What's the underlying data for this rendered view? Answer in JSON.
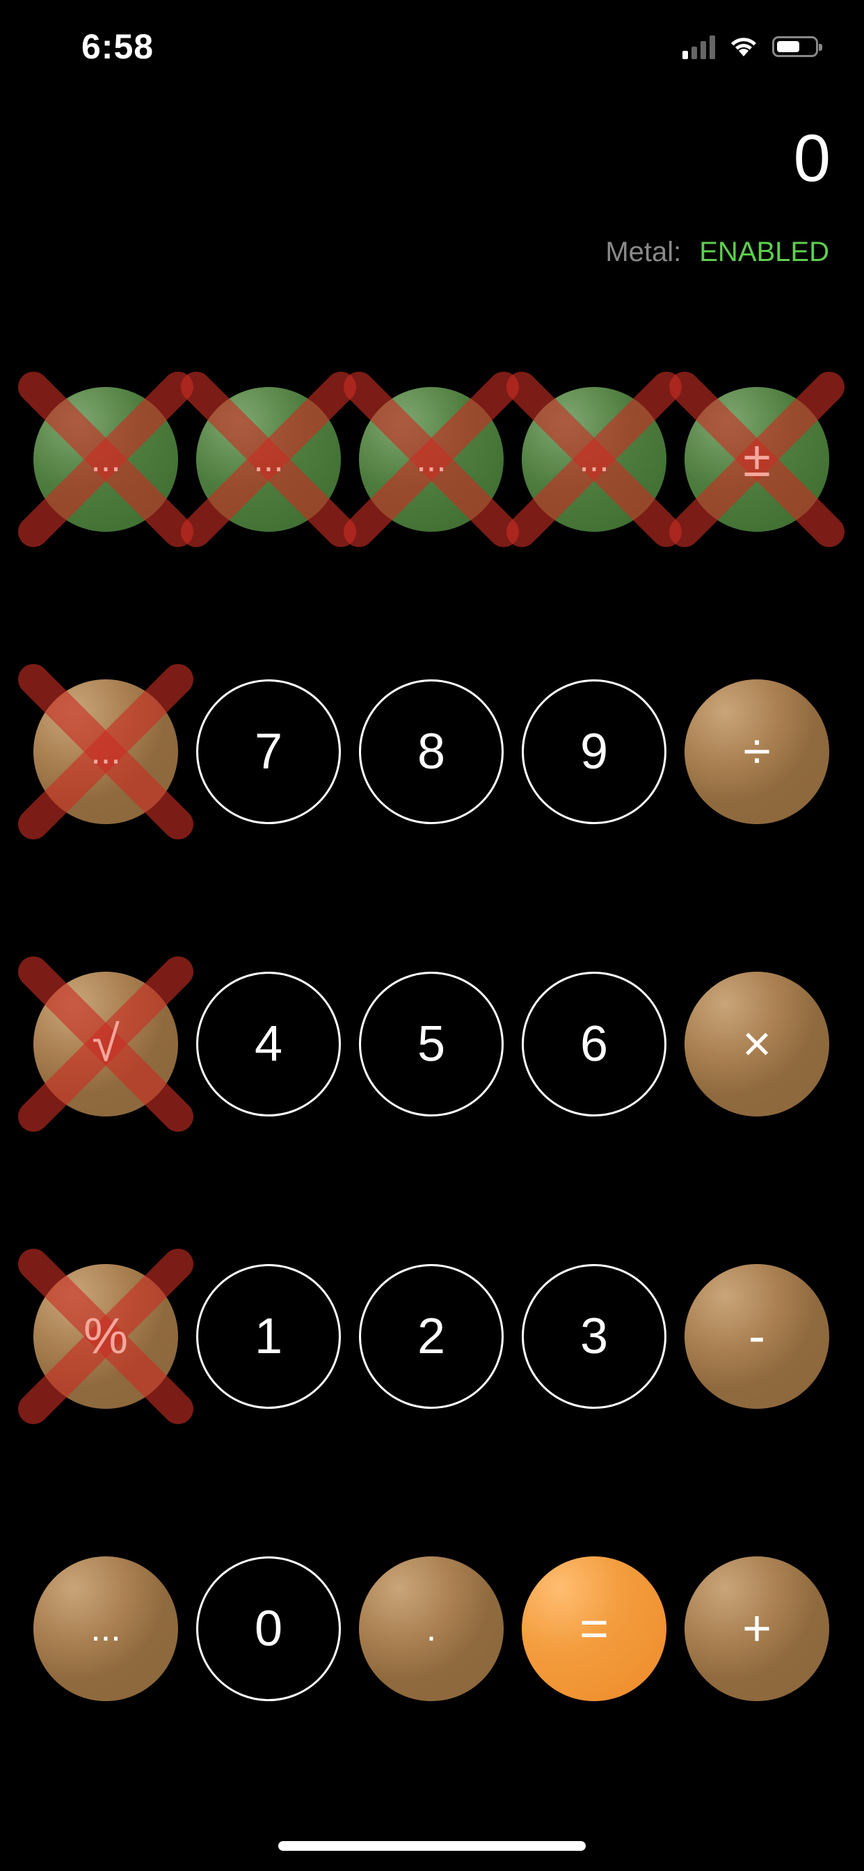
{
  "status_bar": {
    "time": "6:58"
  },
  "display": {
    "value": "0"
  },
  "metal": {
    "label": "Metal:",
    "status": "ENABLED",
    "status_color": "#5fce4f"
  },
  "rows": [
    [
      {
        "label": "...",
        "style": "green",
        "disabled": true
      },
      {
        "label": "...",
        "style": "green",
        "disabled": true
      },
      {
        "label": "...",
        "style": "green",
        "disabled": true
      },
      {
        "label": "...",
        "style": "green",
        "disabled": true
      },
      {
        "label": "±",
        "style": "green",
        "disabled": true
      }
    ],
    [
      {
        "label": "...",
        "style": "brown",
        "disabled": true
      },
      {
        "label": "7",
        "style": "outline",
        "disabled": false
      },
      {
        "label": "8",
        "style": "outline",
        "disabled": false
      },
      {
        "label": "9",
        "style": "outline",
        "disabled": false
      },
      {
        "label": "÷",
        "style": "brown",
        "disabled": false
      }
    ],
    [
      {
        "label": "√",
        "style": "brown",
        "disabled": true
      },
      {
        "label": "4",
        "style": "outline",
        "disabled": false
      },
      {
        "label": "5",
        "style": "outline",
        "disabled": false
      },
      {
        "label": "6",
        "style": "outline",
        "disabled": false
      },
      {
        "label": "×",
        "style": "brown",
        "disabled": false
      }
    ],
    [
      {
        "label": "%",
        "style": "brown",
        "disabled": true
      },
      {
        "label": "1",
        "style": "outline",
        "disabled": false
      },
      {
        "label": "2",
        "style": "outline",
        "disabled": false
      },
      {
        "label": "3",
        "style": "outline",
        "disabled": false
      },
      {
        "label": "-",
        "style": "brown",
        "disabled": false
      }
    ],
    [
      {
        "label": "...",
        "style": "brown",
        "disabled": false
      },
      {
        "label": "0",
        "style": "outline",
        "disabled": false
      },
      {
        "label": ".",
        "style": "brown",
        "disabled": false
      },
      {
        "label": "=",
        "style": "orange",
        "disabled": false
      },
      {
        "label": "+",
        "style": "brown",
        "disabled": false
      }
    ]
  ]
}
